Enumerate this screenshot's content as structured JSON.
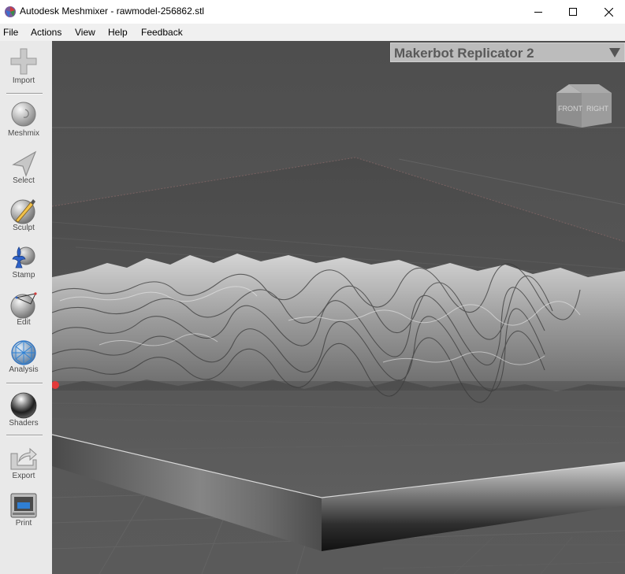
{
  "window": {
    "title": "Autodesk Meshmixer - rawmodel-256862.stl",
    "icon": "meshmixer-app-icon",
    "controls": [
      "minimize-icon",
      "maximize-icon",
      "close-icon"
    ]
  },
  "menu": {
    "file": "File",
    "actions": "Actions",
    "view": "View",
    "help": "Help",
    "feedback": "Feedback"
  },
  "toolbar": {
    "import": "Import",
    "meshmix": "Meshmix",
    "select": "Select",
    "sculpt": "Sculpt",
    "stamp": "Stamp",
    "edit": "Edit",
    "analysis": "Analysis",
    "shaders": "Shaders",
    "export": "Export",
    "print": "Print"
  },
  "viewport": {
    "printer": "Makerbot Replicator 2",
    "viewcube": {
      "front": "FRONT",
      "right": "RIGHT"
    },
    "background_color": "#555555",
    "accent_color": "#e23a3a"
  }
}
